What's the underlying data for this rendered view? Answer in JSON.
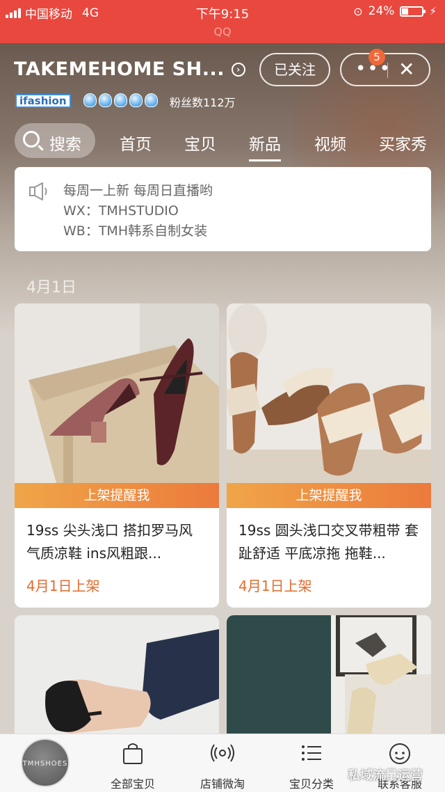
{
  "status_bar": {
    "carrier": "中国移动",
    "network": "4G",
    "time": "下午9:15",
    "battery": "24%",
    "app_label": "QQ"
  },
  "shop": {
    "name": "TAKEMEHOME SH...",
    "follow_label": "已关注",
    "notification_count": "5",
    "ifashion_label": "ifashion",
    "fans": "粉丝数112万"
  },
  "nav": {
    "search_label": "搜索",
    "tabs": [
      "首页",
      "宝贝",
      "新品",
      "视频",
      "买家秀"
    ],
    "active_tab": "新品"
  },
  "notice": {
    "lines": [
      "每周一上新 每周日直播哟",
      "WX：TMHSTUDIO",
      "WB：TMH韩系自制女装"
    ]
  },
  "date_group": "4月1日",
  "products": [
    {
      "remind_label": "上架提醒我",
      "title": "19ss 尖头浅口 搭扣罗马风 气质凉鞋 ins风粗跟...",
      "date": "4月1日上架"
    },
    {
      "remind_label": "上架提醒我",
      "title": "19ss 圆头浅口交叉带粗带 套趾舒适 平底凉拖 拖鞋...",
      "date": "4月1日上架"
    }
  ],
  "bottom_bar": {
    "logo_text": "TMHSHOES",
    "items": [
      "全部宝贝",
      "店铺微淘",
      "宝贝分类",
      "联系客服"
    ]
  },
  "watermark": "私域流量运营",
  "colors": {
    "status_red": "#e9483f",
    "accent_orange": "#ec7a3c",
    "date_orange": "#e36b2c"
  }
}
